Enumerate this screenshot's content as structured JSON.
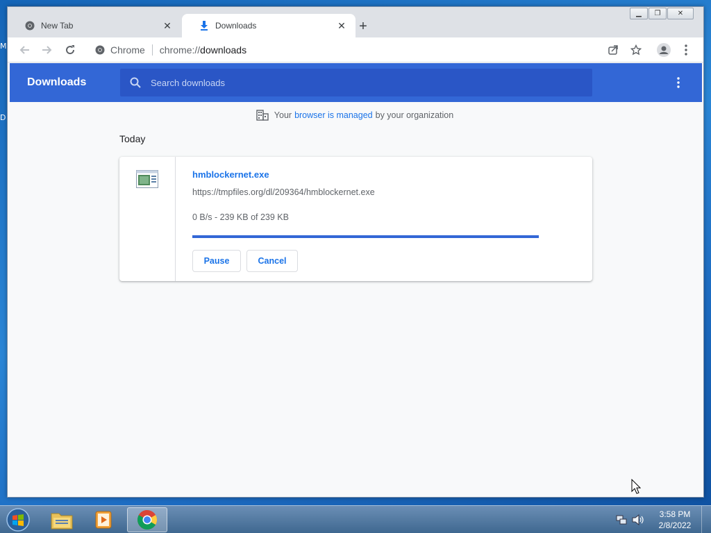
{
  "desktop": {
    "edge_letters": [
      "M",
      "D"
    ]
  },
  "browser": {
    "tabs": [
      {
        "title": "New Tab",
        "icon": "chrome-icon"
      },
      {
        "title": "Downloads",
        "icon": "download-icon"
      }
    ],
    "address": {
      "chip": "Chrome",
      "scheme": "chrome://",
      "host": "downloads"
    }
  },
  "downloads_page": {
    "title": "Downloads",
    "search_placeholder": "Search downloads",
    "managed_notice": {
      "prefix": "Your",
      "link": "browser is managed",
      "suffix": "by your organization"
    },
    "section_label": "Today",
    "items": [
      {
        "file_name": "hmblockernet.exe",
        "url": "https://tmpfiles.org/dl/209364/hmblockernet.exe",
        "status": "0 B/s - 239 KB of 239 KB",
        "progress": 1.0,
        "pause_label": "Pause",
        "cancel_label": "Cancel"
      }
    ]
  },
  "taskbar": {
    "apps": [
      "explorer-icon",
      "media-player-icon",
      "chrome-icon"
    ],
    "clock": {
      "time": "3:58 PM",
      "date": "2/8/2022"
    }
  },
  "colors": {
    "accent": "#3367d6",
    "link": "#1a73e8"
  }
}
